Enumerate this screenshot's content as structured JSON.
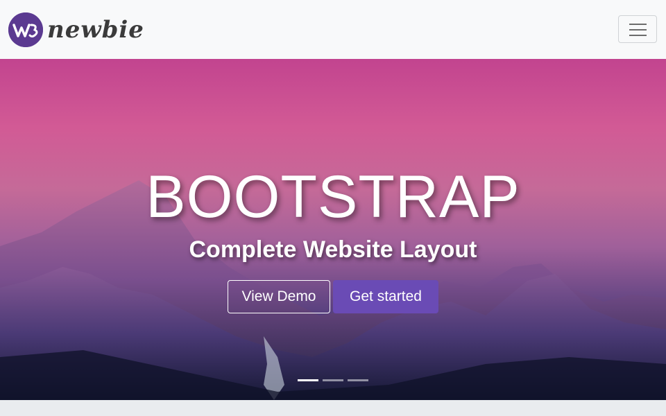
{
  "navbar": {
    "brand_name": "newbie",
    "brand_logo_letters": "W3",
    "toggler_icon": "hamburger-menu-icon"
  },
  "hero": {
    "title": "BOOTSTRAP",
    "subtitle": "Complete Website Layout",
    "buttons": {
      "demo_label": "View Demo",
      "start_label": "Get started"
    },
    "carousel": {
      "slide_count": 3,
      "active_index": 0
    }
  },
  "colors": {
    "navbar_bg": "#f8f9fa",
    "brand_purple": "#5b3a91",
    "accent_button": "#6a4bb5",
    "page_bg": "#e9ecef"
  }
}
